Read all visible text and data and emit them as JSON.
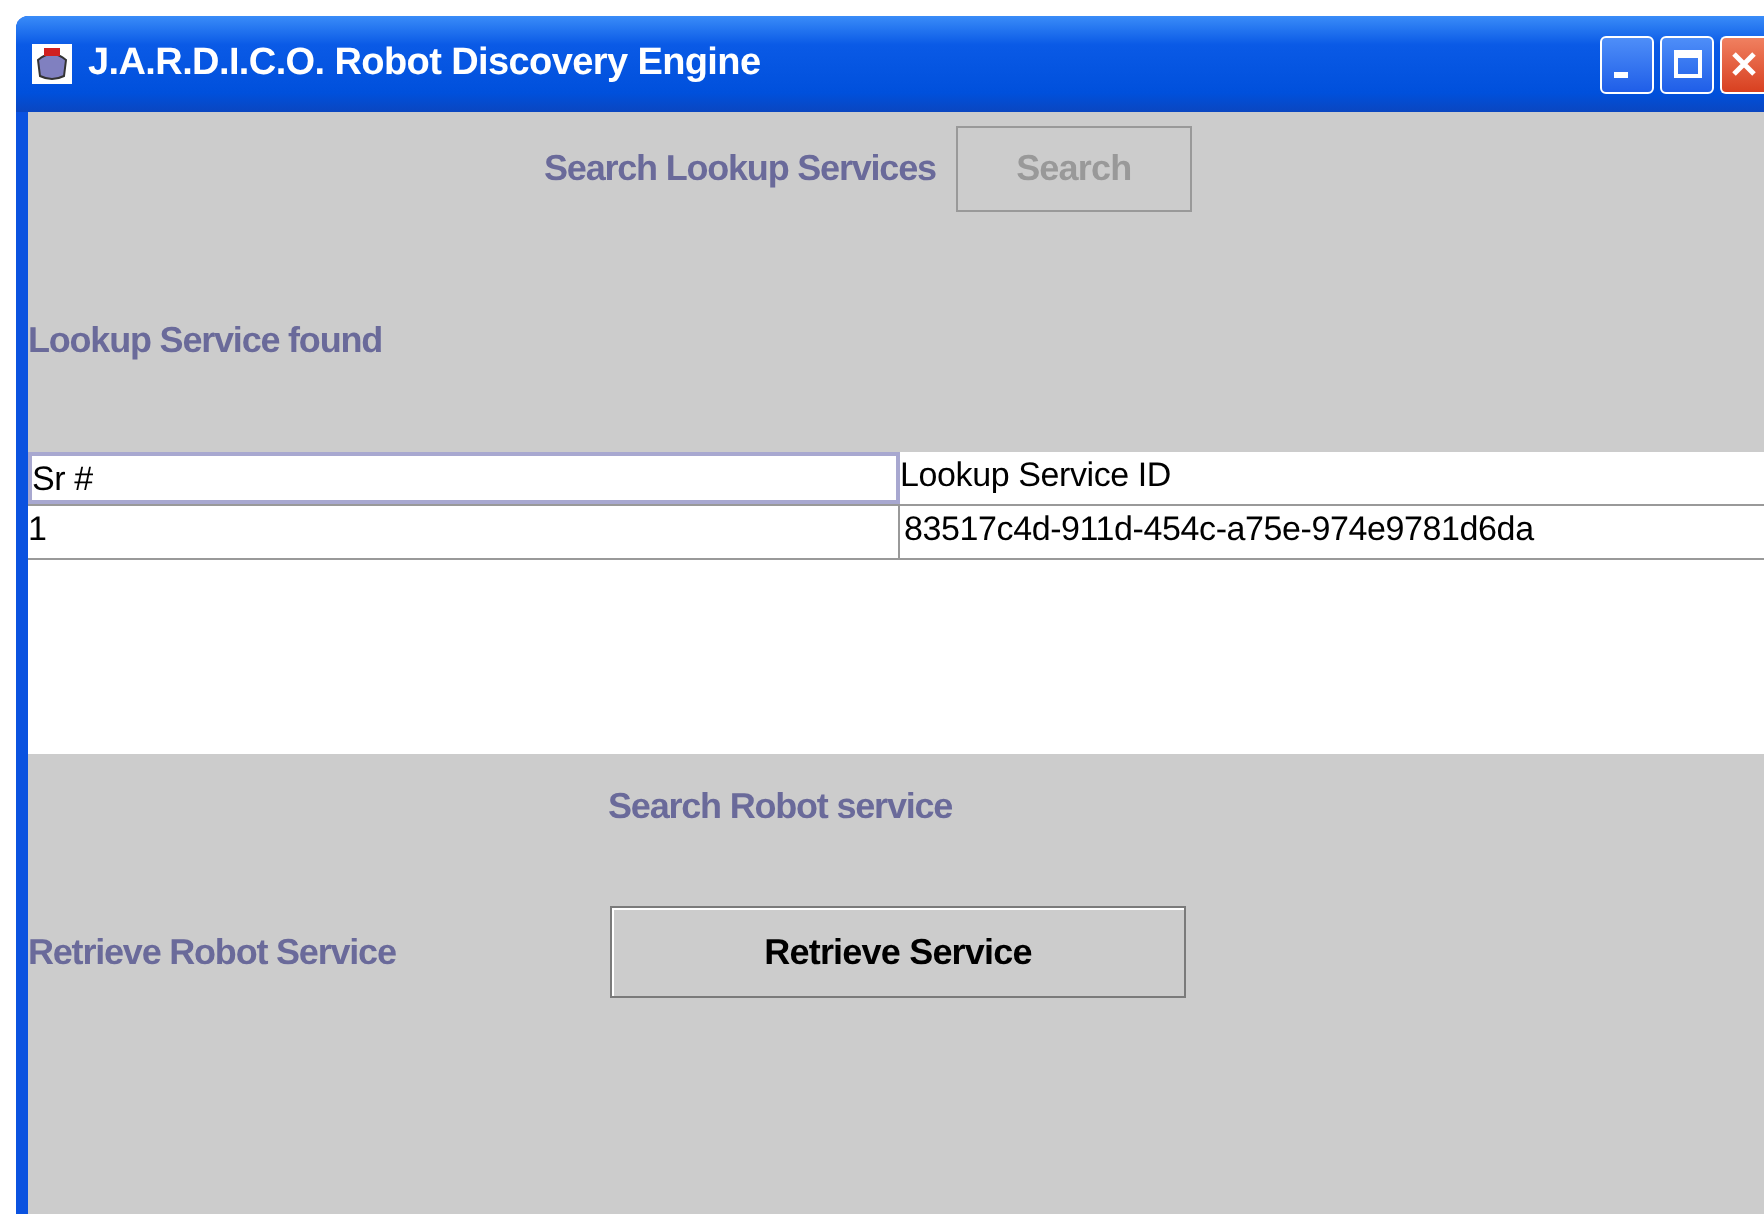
{
  "window": {
    "title": "J.A.R.D.I.C.O. Robot Discovery Engine"
  },
  "search_lookup": {
    "label": "Search Lookup Services",
    "button": {
      "label": "Search",
      "disabled": true
    }
  },
  "found_label": "Lookup Service found",
  "table": {
    "columns": [
      "Sr #",
      "Lookup Service ID"
    ],
    "rows": [
      [
        "1",
        "83517c4d-911d-454c-a75e-974e9781d6da"
      ]
    ]
  },
  "robot_section_title": "Search Robot service",
  "retrieve": {
    "label": "Retrieve Robot Service",
    "button": {
      "label": "Retrieve Service",
      "disabled": false
    }
  }
}
